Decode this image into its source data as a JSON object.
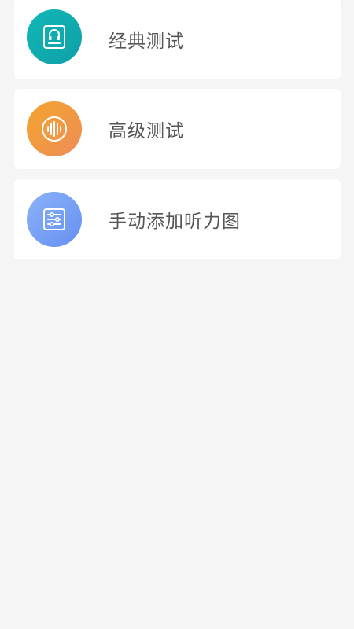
{
  "menu": {
    "items": [
      {
        "label": "经典测试",
        "icon": "headphones-card-icon",
        "color_from": "#10b3b3",
        "color_to": "#13a3aa"
      },
      {
        "label": "高级测试",
        "icon": "sound-wave-icon",
        "color_from": "#f2a033",
        "color_to": "#ef8f55"
      },
      {
        "label": "手动添加听力图",
        "icon": "sliders-icon",
        "color_from": "#85aef7",
        "color_to": "#6a93f2"
      }
    ]
  }
}
